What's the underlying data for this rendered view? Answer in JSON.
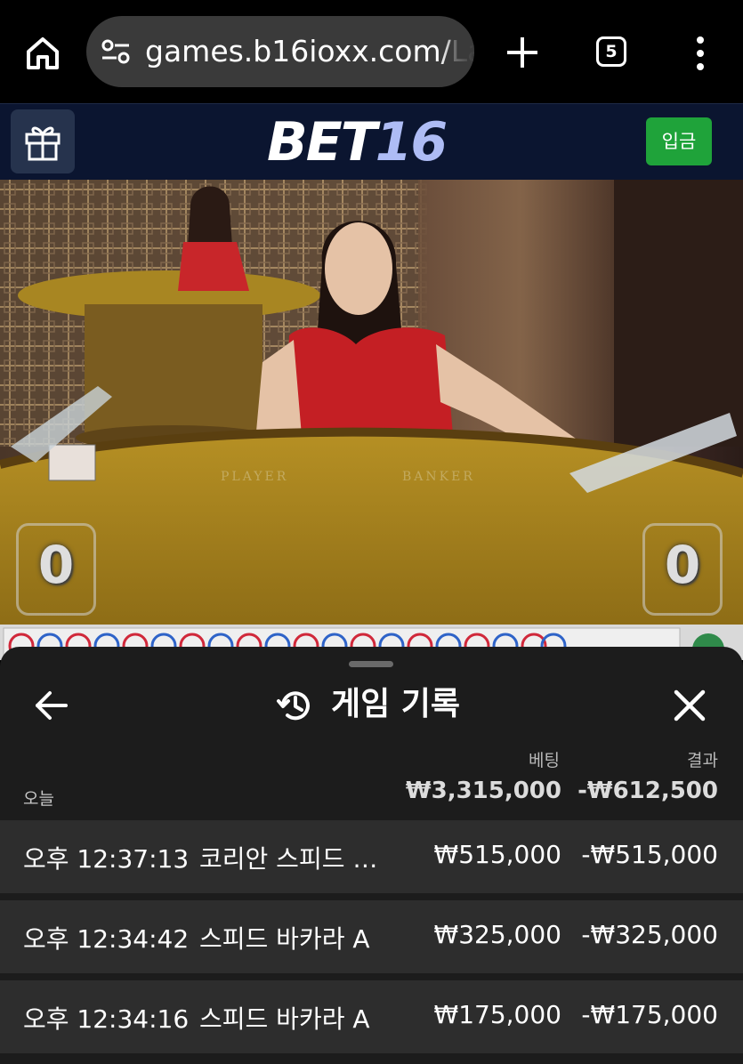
{
  "browser": {
    "url_main": "games.b16ioxx.com/",
    "url_tail": "La",
    "tab_count": "5"
  },
  "site": {
    "logo_bet": "BET",
    "logo_num": "16",
    "deposit_label": "입금"
  },
  "video": {
    "player_label": "PLAYER",
    "banker_label": "BANKER",
    "player_score": "0",
    "banker_score": "0"
  },
  "sheet": {
    "title": "게임 기록",
    "col_bet": "베팅",
    "col_result": "결과",
    "today_label": "오늘",
    "total_bet": "₩3,315,000",
    "total_result": "-₩612,500",
    "rows": [
      {
        "time": "오후 12:37:13",
        "game": "코리안 스피드 바...",
        "bet": "₩515,000",
        "result": "-₩515,000"
      },
      {
        "time": "오후 12:34:42",
        "game": "스피드 바카라 A",
        "bet": "₩325,000",
        "result": "-₩325,000"
      },
      {
        "time": "오후 12:34:16",
        "game": "스피드 바카라 A",
        "bet": "₩175,000",
        "result": "-₩175,000"
      }
    ]
  },
  "icons": {
    "home": "home-icon",
    "url_settings": "tune-icon",
    "new_tab": "plus-icon",
    "menu": "more-vert-icon",
    "gift": "gift-icon",
    "back": "arrow-left-icon",
    "history": "history-icon",
    "close": "close-icon"
  },
  "colors": {
    "header_bg": "#0b1530",
    "deposit_green": "#1fa33a",
    "sheet_bg": "#1c1c1c",
    "row_bg": "#2d2d2d",
    "logo_accent": "#aebcf5"
  }
}
